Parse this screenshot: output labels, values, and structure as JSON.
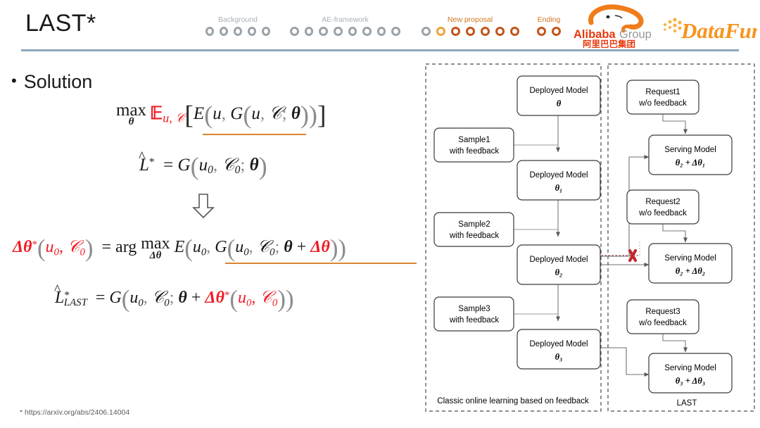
{
  "header": {
    "title": "LAST*",
    "nav_groups": [
      {
        "label": "Background",
        "dots": [
          "gray",
          "gray",
          "gray",
          "gray",
          "gray"
        ]
      },
      {
        "label": "AE-framework",
        "dots": [
          "gray",
          "gray",
          "gray",
          "gray",
          "gray",
          "gray",
          "gray",
          "gray"
        ]
      },
      {
        "label": "New proposal",
        "dots": [
          "gray",
          "current",
          "done",
          "done",
          "done",
          "done",
          "done"
        ]
      },
      {
        "label": "Ending",
        "dots": [
          "done",
          "done"
        ]
      }
    ],
    "logos": {
      "alibaba": {
        "name": "alibaba-group-logo",
        "line1": "Alibaba",
        "line2": "Group",
        "cn": "阿里巴巴集团"
      },
      "datafun": {
        "name": "datafun-logo",
        "text": "DataFun."
      }
    },
    "colors": {
      "rule": "#8ea9bd",
      "dot_gray": "#9aa2a8",
      "dot_current": "#eda13c",
      "dot_done": "#c3541b",
      "label_gray": "#a7b0b7",
      "label_orange": "#d4741d",
      "accent_underline": "#d98430",
      "highlight_red": "#ee1c25"
    }
  },
  "content": {
    "bullet": "Solution",
    "footnote": "* https://arxiv.org/abs/2406.14004",
    "formulas": {
      "f1_plain": "max_θ E_{u,C}[ E( u, G(u, C; θ) ) ]",
      "f2_plain": "L̂* = G(u₀, C₀; θ)",
      "f3_plain": "Δθ*(u₀, C₀) = arg max_{Δθ} E( u₀, G(u₀, C₀; θ + Δθ) )",
      "f4_plain": "L̂*_LAST = G(u₀, C₀; θ + Δθ*(u₀, C₀))"
    }
  },
  "diagram": {
    "left_panel": {
      "caption": "Classic online learning based on feedback",
      "models": [
        {
          "line1": "Deployed Model",
          "line2": "θ"
        },
        {
          "line1": "Deployed Model",
          "line2": "θ₁"
        },
        {
          "line1": "Deployed Model",
          "line2": "θ₂"
        },
        {
          "line1": "Deployed Model",
          "line2": "θ₃"
        }
      ],
      "samples": [
        {
          "line1": "Sample1",
          "line2": "with feedback"
        },
        {
          "line1": "Sample2",
          "line2": "with feedback"
        },
        {
          "line1": "Sample3",
          "line2": "with feedback"
        }
      ]
    },
    "right_panel": {
      "caption": "LAST",
      "requests": [
        {
          "line1": "Request1",
          "line2": "w/o feedback"
        },
        {
          "line1": "Request2",
          "line2": "w/o feedback"
        },
        {
          "line1": "Request3",
          "line2": "w/o feedback"
        }
      ],
      "serving": [
        {
          "line1": "Serving Model",
          "line2": "θ₂ + Δθ₁"
        },
        {
          "line1": "Serving Model",
          "line2": "θ₂  + Δθ₂"
        },
        {
          "line1": "Serving Model",
          "line2": "θ₃  + Δθ₃"
        }
      ],
      "blocked_marker": "✖"
    }
  }
}
